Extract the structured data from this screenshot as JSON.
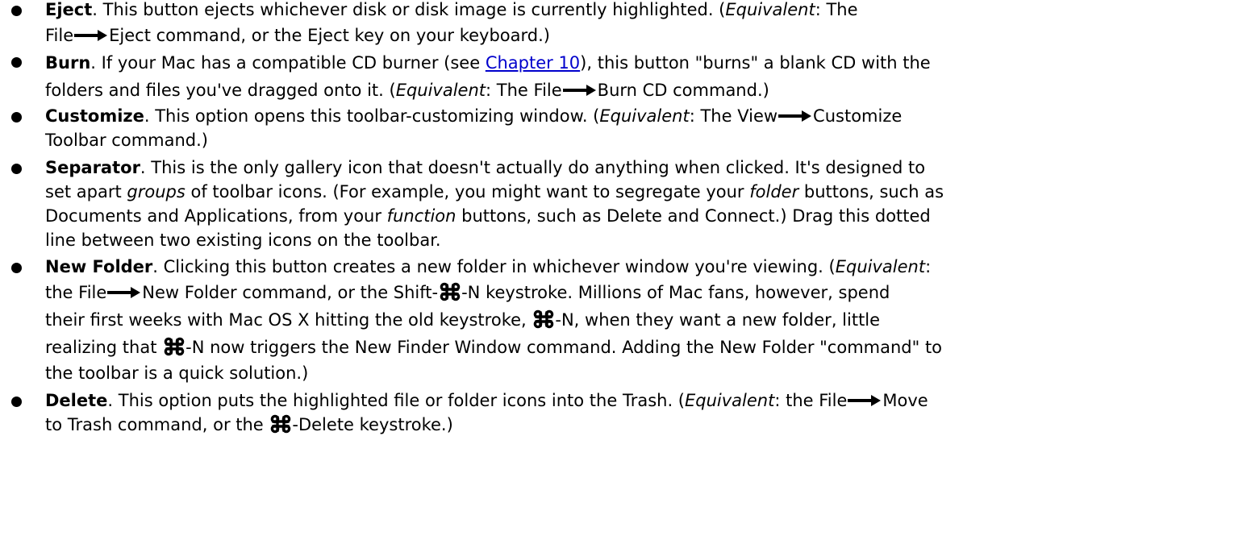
{
  "items": [
    {
      "term": "Eject",
      "l1": ". This button ejects whichever disk or disk image is currently highlighted. (",
      "l1_equiv": "Equivalent",
      "l1_tail": ": The",
      "l2_a": "File",
      "l2_b": "Eject command, or the Eject key on your keyboard.)"
    },
    {
      "term": "Burn",
      "l1_a": ". If your Mac has a compatible CD burner (see ",
      "l1_link": "Chapter 10",
      "l1_b": "), this button \"burns\" a blank CD with the",
      "l2_a": "folders and files you've dragged onto it. (",
      "l2_equiv": "Equivalent",
      "l2_b": ": The File",
      "l2_c": "Burn CD command.)"
    },
    {
      "term": "Customize",
      "l1_a": ". This option opens this toolbar-customizing window. (",
      "l1_equiv": "Equivalent",
      "l1_b": ": The View",
      "l1_c": "Customize",
      "l2": "Toolbar command.)"
    },
    {
      "term": "Separator",
      "l1": ". This is the only gallery icon that doesn't actually do anything when clicked. It's designed to",
      "l2_a": "set apart ",
      "l2_groups": "groups",
      "l2_b": " of toolbar icons. (For example, you might want to segregate your ",
      "l2_folder": "folder",
      "l2_c": " buttons, such as",
      "l3_a": "Documents and Applications, from your ",
      "l3_function": "function",
      "l3_b": " buttons, such as Delete and Connect.) Drag this dotted",
      "l4": "line between two existing icons on the toolbar."
    },
    {
      "term": "New Folder",
      "l1_a": ". Clicking this button creates a new folder in whichever window you're viewing. (",
      "l1_equiv": "Equivalent",
      "l1_b": ":",
      "l2_a": "the File",
      "l2_b": "New Folder command, or the Shift-",
      "l2_c": "-N keystroke. Millions of Mac fans, however, spend",
      "l3_a": "their first weeks with Mac OS X hitting the old keystroke, ",
      "l3_b": "-N, when they want a new folder, little",
      "l4_a": "realizing that ",
      "l4_b": "-N now triggers the New Finder Window command. Adding the New Folder \"command\" to",
      "l5": "the toolbar is a quick solution.)"
    },
    {
      "term": "Delete",
      "l1_a": ". This option puts the highlighted file or folder icons into the Trash. (",
      "l1_equiv": "Equivalent",
      "l1_b": ": the File",
      "l1_c": "Move",
      "l2_a": "to Trash command, or the ",
      "l2_b": "-Delete keystroke.)"
    }
  ]
}
